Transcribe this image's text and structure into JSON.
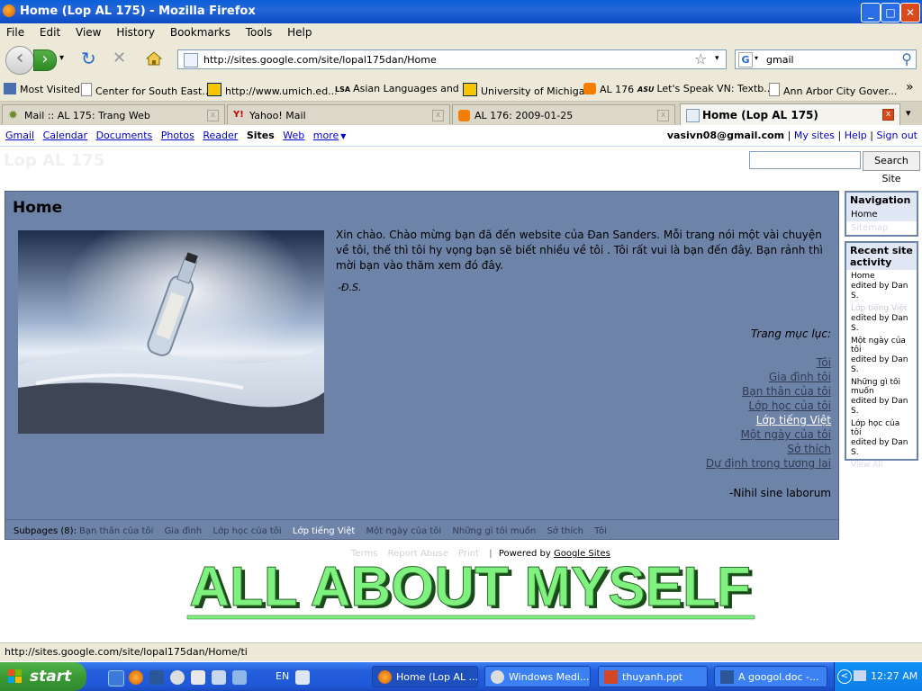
{
  "window": {
    "title": "Home (Lop AL 175) - Mozilla Firefox"
  },
  "menu": [
    "File",
    "Edit",
    "View",
    "History",
    "Bookmarks",
    "Tools",
    "Help"
  ],
  "address": {
    "url": "http://sites.google.com/site/lopal175dan/Home"
  },
  "search": {
    "value": "gmail",
    "engine_glyph": "G"
  },
  "bookmarks": [
    "Most Visited",
    "Center for South East...",
    "http://www.umich.ed...",
    "Asian Languages and ...",
    "University of Michigan",
    "AL 176",
    "Let's Speak VN: Textb...",
    "Ann Arbor City Gover..."
  ],
  "bookmark_icons": {
    "lsa": "LSA",
    "asu": "ASU",
    "more": "»"
  },
  "tabs": [
    {
      "label": "Mail :: AL 175: Trang Web"
    },
    {
      "label": "Yahoo! Mail"
    },
    {
      "label": "AL 176: 2009-01-25"
    },
    {
      "label": "Home (Lop AL 175)"
    }
  ],
  "yahoo_glyph": "Y!",
  "gbar": {
    "links": [
      "Gmail",
      "Calendar",
      "Documents",
      "Photos",
      "Reader",
      "Sites",
      "Web",
      "more"
    ],
    "more_arrow": "▼",
    "email": "vasivn08@gmail.com",
    "my_sites": "My sites",
    "help": "Help",
    "sign_out": "Sign out",
    "sep": "|"
  },
  "site": {
    "title": "Lop AL 175",
    "search_button": "Search Site"
  },
  "page": {
    "heading": "Home",
    "intro": "Xin chào. Chào mừng bạn đã đến website của Đan Sanders. Mỗi trang nói một vài chuyện về tôi, thế thì tôi hy vọng bạn sẽ biết nhiều về tôi . Tôi rất vui là bạn đến đây. Bạn rảnh thì mời bạn vào thăm xem đó đây.",
    "signature": "-Đ.S.",
    "toc_heading": "Trang mục lục:",
    "toc": [
      "Tôi",
      "Gia đình tôi",
      "Bạn thân của tôi",
      "Lớp học của tôi",
      "Lớp tiếng Việt",
      "Một ngày của tôi",
      "Sở thích",
      "Dự định trong tương lai"
    ],
    "motto": "-Nihil sine laborum"
  },
  "subpages": {
    "label": "Subpages (8):",
    "items": [
      "Bạn thân của tôi",
      "Gia đình",
      "Lớp học của tôi",
      "Lớp tiếng Việt",
      "Một ngày của tôi",
      "Những gì tôi muốn",
      "Sở thích",
      "Tôi"
    ]
  },
  "sidebar": {
    "nav_title": "Navigation",
    "nav_items": [
      "Home",
      "Sitemap"
    ],
    "activity_title": "Recent site activity",
    "activity": [
      {
        "page": "Home",
        "by": "edited by Dan S."
      },
      {
        "page": "Lớp tiếng Việt",
        "by": "edited by Dan S."
      },
      {
        "page": "Một ngày của tôi",
        "by": "edited by Dan S."
      },
      {
        "page": "Những gì tôi muốn",
        "by": "edited by Dan S."
      },
      {
        "page": "Lớp học của tôi",
        "by": "edited by Dan S."
      }
    ],
    "view_all": "View All"
  },
  "footer": {
    "terms": "Terms",
    "report": "Report Abuse",
    "print": "Print",
    "powered": "Powered by",
    "google_sites": "Google Sites",
    "sep": "|"
  },
  "banner": {
    "text": "ALL ABOUT MYSELF"
  },
  "status": {
    "text": "http://sites.google.com/site/lopal175dan/Home/ti"
  },
  "taskbar": {
    "start": "start",
    "lang": "EN",
    "tasks": [
      "Home (Lop AL ...",
      "Windows Medi...",
      "thuyanh.ppt",
      "A googol.doc -..."
    ],
    "time": "12:27 AM",
    "tray_chevron": "<"
  },
  "window_buttons": {
    "minimize": "_",
    "maximize": "□",
    "close": "✕"
  },
  "nav_glyphs": {
    "back": "‹",
    "forward": "›",
    "dropdown": "▾",
    "stop": "✕",
    "reload": "↻",
    "star": "☆",
    "search": "⚲",
    "tab_close": "x",
    "tab_list": "▾"
  }
}
